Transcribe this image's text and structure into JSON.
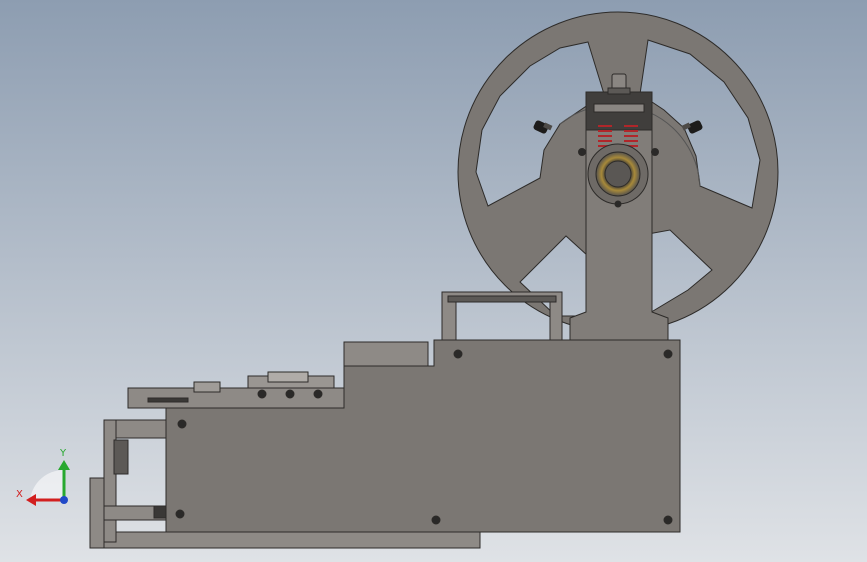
{
  "viewport": {
    "background_top": "#8d9db1",
    "background_bottom": "#dfe2e6"
  },
  "model": {
    "part_color": "#7b7773",
    "part_light": "#8e8a86",
    "part_dark": "#4a4744",
    "edge_color": "#2d2b29",
    "spring_color": "#b0262a",
    "bearing_color": "#a88a3a"
  },
  "triad": {
    "x_label": "X",
    "y_label": "Y",
    "x_color": "#d21f1f",
    "y_color": "#27a82f",
    "z_color": "#2049c8"
  }
}
